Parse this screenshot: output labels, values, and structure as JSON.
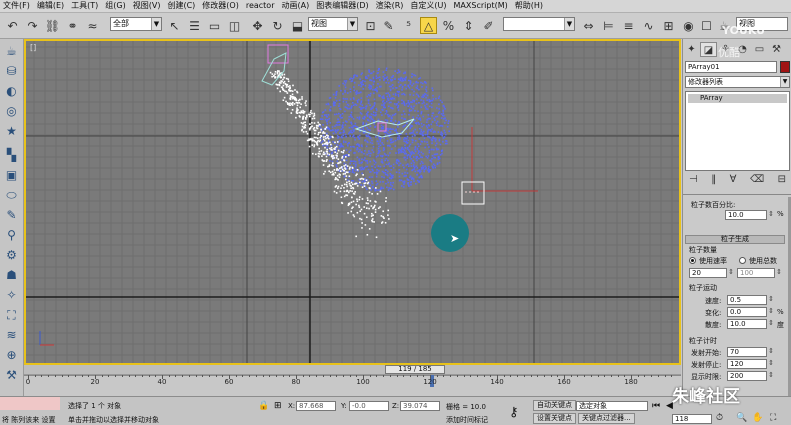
{
  "menubar": {
    "items": [
      "文件(F)",
      "编辑(E)",
      "工具(T)",
      "组(G)",
      "视图(V)",
      "创建(C)",
      "修改器(O)",
      "reactor",
      "动画(A)",
      "图表编辑器(D)",
      "渲染(R)",
      "自定义(U)",
      "MAXScript(M)",
      "帮助(H)"
    ]
  },
  "toolbar": {
    "selection_filter": "全部",
    "ref_coord": "视图",
    "named_selection": "",
    "view_select": "视图"
  },
  "viewport": {
    "label": "[]",
    "selected_color": "#e8c21a",
    "blue_particles_color": "#5a6af0",
    "white_particles_color": "#ffffff"
  },
  "command_panel": {
    "object_name": "PArray01",
    "object_color": "#a01414",
    "modifier_list": "修改器列表",
    "stack_item": "PArray",
    "particle_percent_label": "粒子数百分比:",
    "particle_percent_value": "10.0",
    "particle_percent_unit": "%",
    "particle_gen_head": "粒子生成",
    "particle_qty_head": "粒子数量",
    "use_rate_label": "使用速率",
    "use_total_label": "使用总数",
    "rate_value": "20",
    "total_value": "100",
    "particle_motion_head": "粒子运动",
    "speed_label": "速度:",
    "speed_value": "0.5",
    "variation_label": "变化:",
    "variation_value": "0.0",
    "variation_unit": "%",
    "divergence_label": "散度:",
    "divergence_value": "10.0",
    "divergence_unit": "度",
    "timing_head": "粒子计时",
    "emit_start_label": "发射开始:",
    "emit_start_value": "70",
    "emit_stop_label": "发射停止:",
    "emit_stop_value": "120",
    "display_until_label": "显示时限:",
    "display_until_value": "200"
  },
  "timeslider": {
    "frame_text": "119 / 185",
    "current_frame": 119,
    "total_frames": 185,
    "ticks": [
      "0",
      "20",
      "40",
      "60",
      "80",
      "100",
      "120",
      "140",
      "160",
      "180"
    ]
  },
  "statusbar": {
    "left_red": "将 陈列该来 设置",
    "selection_text": "选择了 1 个 对象",
    "prompt_text": "单击并拖动以选择并移动对象",
    "x_label": "X:",
    "x_value": "87.668",
    "y_label": "Y:",
    "y_value": "-0.0",
    "z_label": "Z:",
    "z_value": "39.074",
    "grid_text": "栅格 = 10.0",
    "add_time_tag": "添加时间标记",
    "auto_key": "自动关键点",
    "set_key": "设置关键点",
    "key_filter_select": "选定对象",
    "key_filters": "关键点过滤器...",
    "frame_field": "118"
  },
  "watermarks": {
    "youku": "YOUKU",
    "youku_cn": "优酷",
    "site": "朱峰社区"
  }
}
